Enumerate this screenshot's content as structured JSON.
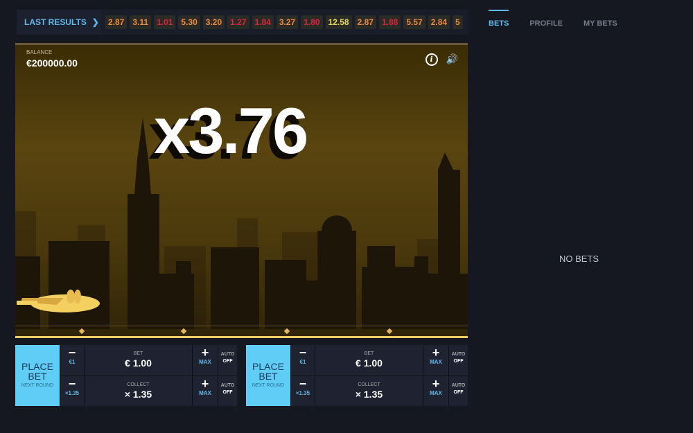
{
  "last_results": {
    "label": "LAST RESULTS",
    "values": [
      {
        "v": "2.87",
        "c": "#f08a3c"
      },
      {
        "v": "3.11",
        "c": "#f08a3c"
      },
      {
        "v": "1.01",
        "c": "#d8283a"
      },
      {
        "v": "5.30",
        "c": "#f08a3c"
      },
      {
        "v": "3.20",
        "c": "#f08a3c"
      },
      {
        "v": "1.27",
        "c": "#d8283a"
      },
      {
        "v": "1.84",
        "c": "#d8283a"
      },
      {
        "v": "3.27",
        "c": "#f08a3c"
      },
      {
        "v": "1.80",
        "c": "#d8283a"
      },
      {
        "v": "12.58",
        "c": "#e8d85a"
      },
      {
        "v": "2.87",
        "c": "#f08a3c"
      },
      {
        "v": "1.88",
        "c": "#d8283a"
      },
      {
        "v": "5.57",
        "c": "#f08a3c"
      },
      {
        "v": "2.84",
        "c": "#f08a3c"
      },
      {
        "v": "5",
        "c": "#f08a3c"
      }
    ]
  },
  "game": {
    "balance_label": "BALANCE",
    "balance": "€200000.00",
    "multiplier": "x3.76"
  },
  "panels": [
    {
      "place": "PLACE BET",
      "next": "NEXT ROUND",
      "bet_label": "BET",
      "bet": "€ 1.00",
      "bet_step": "€1",
      "collect_label": "COLLECT",
      "collect": "× 1.35",
      "collect_step": "×1.35",
      "max": "MAX",
      "auto": "AUTO",
      "off": "OFF",
      "minus": "−",
      "plus": "+"
    },
    {
      "place": "PLACE BET",
      "next": "NEXT ROUND",
      "bet_label": "BET",
      "bet": "€ 1.00",
      "bet_step": "€1",
      "collect_label": "COLLECT",
      "collect": "× 1.35",
      "collect_step": "×1.35",
      "max": "MAX",
      "auto": "AUTO",
      "off": "OFF",
      "minus": "−",
      "plus": "+"
    }
  ],
  "tabs": [
    {
      "label": "BETS",
      "active": true
    },
    {
      "label": "PROFILE"
    },
    {
      "label": "MY BETS"
    }
  ],
  "empty": "NO BETS"
}
